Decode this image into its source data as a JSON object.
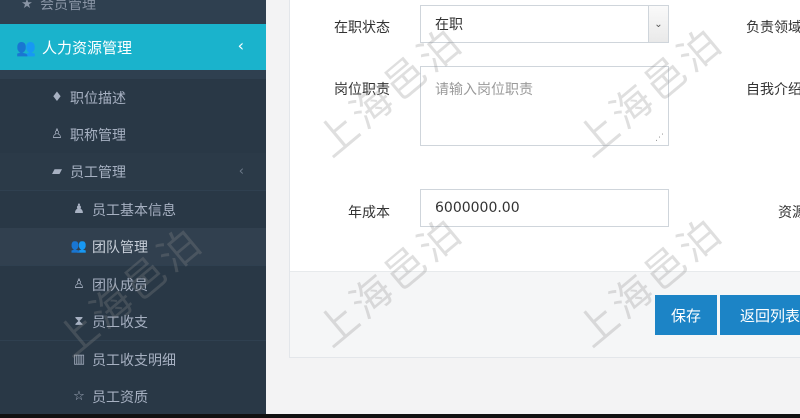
{
  "sidebar": {
    "prev_item": "会员管理",
    "active_group": "人力资源管理",
    "items": [
      {
        "label": "职位描述",
        "icon": "diamond-icon"
      },
      {
        "label": "职称管理",
        "icon": "user-outline-icon"
      },
      {
        "label": "员工管理",
        "icon": "lock-icon"
      }
    ],
    "sub_items": [
      {
        "label": "员工基本信息",
        "icon": "user-icon"
      },
      {
        "label": "团队管理",
        "icon": "users-icon"
      },
      {
        "label": "团队成员",
        "icon": "user-outline-icon"
      },
      {
        "label": "员工收支",
        "icon": "hourglass-icon"
      },
      {
        "label": "员工收支明细",
        "icon": "map-icon"
      },
      {
        "label": "员工资质",
        "icon": "star-icon"
      }
    ]
  },
  "form": {
    "status_label": "在职状态",
    "status_value": "在职",
    "responsible_label": "负责领域",
    "duty_label": "岗位职责",
    "duty_placeholder": "请输入岗位职责",
    "intro_label": "自我介绍",
    "cost_label": "年成本",
    "cost_value": "6000000.00",
    "resource_label": "资源"
  },
  "buttons": {
    "save": "保存",
    "back": "返回列表"
  },
  "watermark": "上海邑泊"
}
